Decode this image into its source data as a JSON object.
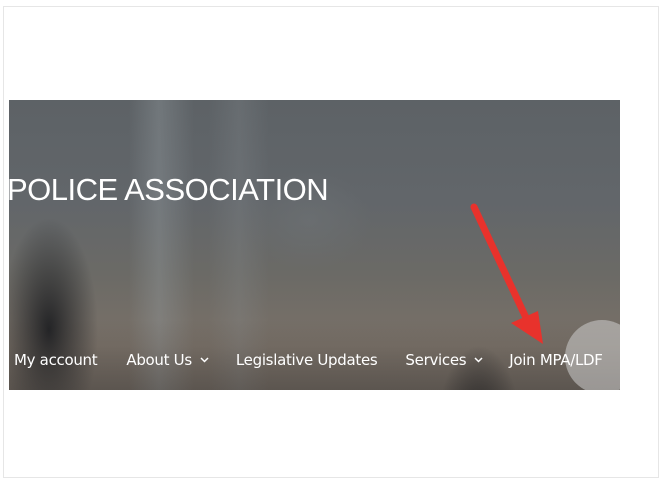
{
  "header": {
    "title": "POLICE ASSOCIATION"
  },
  "nav": {
    "items": [
      {
        "label": "My account",
        "has_dropdown": false
      },
      {
        "label": "About Us",
        "has_dropdown": true
      },
      {
        "label": "Legislative Updates",
        "has_dropdown": false
      },
      {
        "label": "Services",
        "has_dropdown": true
      },
      {
        "label": "Join MPA/LDF",
        "has_dropdown": false
      }
    ],
    "dropdown_glyph": "⌄"
  },
  "annotation": {
    "arrow_color": "#e8322c",
    "target": "Join MPA/LDF"
  },
  "icons": {
    "dropdown": "chevron-down-icon"
  }
}
